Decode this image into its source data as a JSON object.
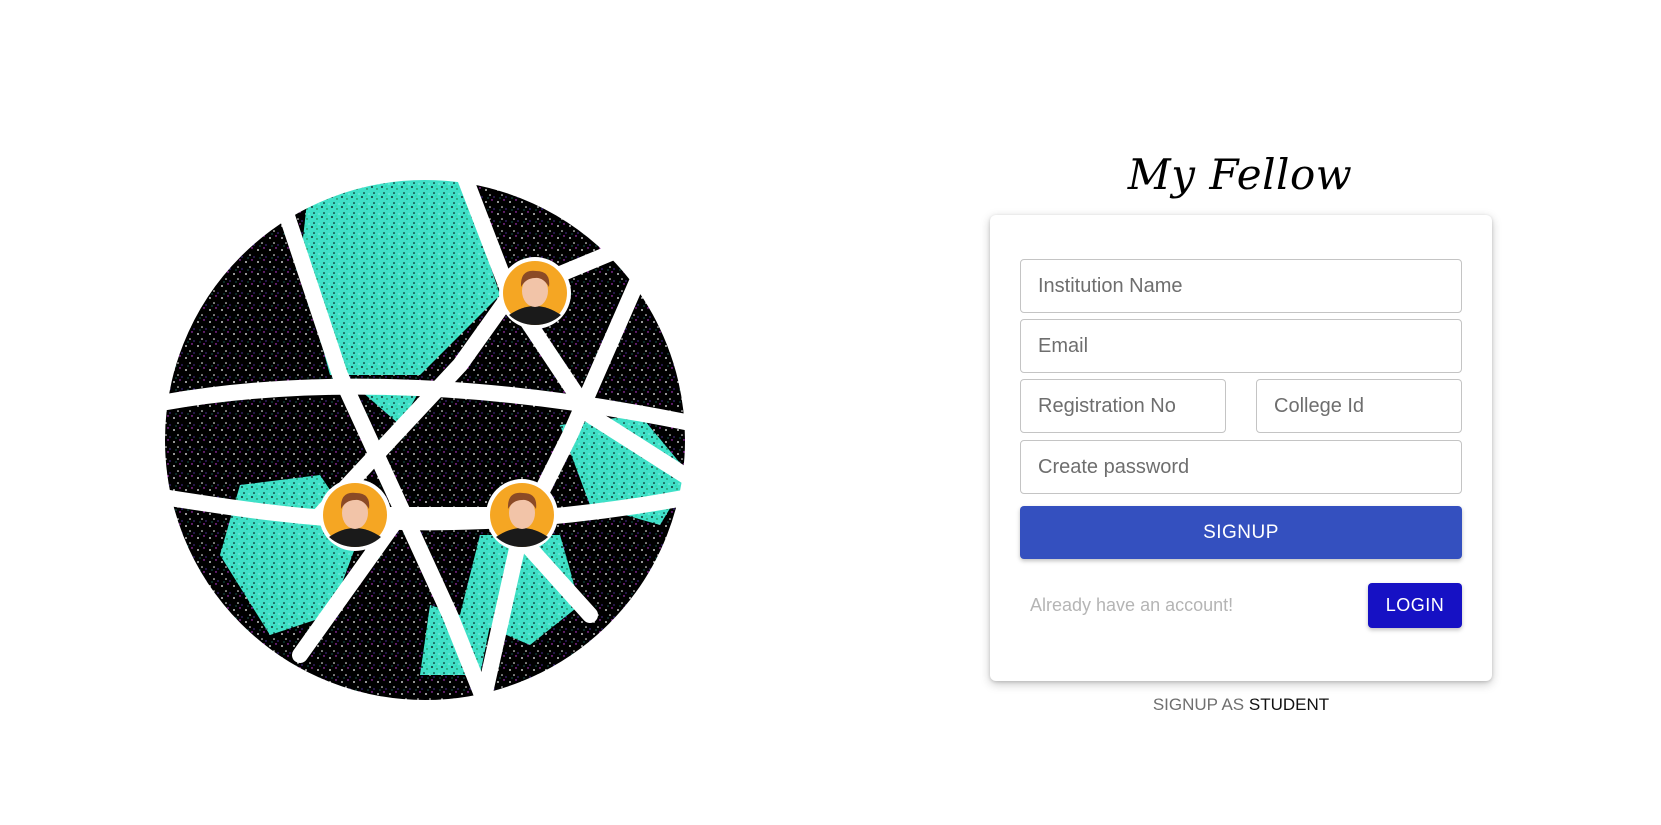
{
  "brand": {
    "title": "My Fellow"
  },
  "form": {
    "institution_placeholder": "Institution Name",
    "email_placeholder": "Email",
    "registration_placeholder": "Registration No",
    "college_id_placeholder": "College Id",
    "password_placeholder": "Create password",
    "signup_label": "SIGNUP",
    "already_text": "Already have an account!",
    "login_label": "LOGIN"
  },
  "footer": {
    "prefix": "SIGNUP AS",
    "role": "STUDENT"
  },
  "colors": {
    "signup_button": "#3450bf",
    "login_button": "#1611c4",
    "globe_dark": "#000000",
    "globe_teal": "#3fe0c8",
    "avatar_bg": "#f5a623"
  },
  "illustration": {
    "icon": "network-globe-icon",
    "avatars": [
      "person-avatar-icon",
      "person-avatar-icon",
      "person-avatar-icon"
    ]
  }
}
